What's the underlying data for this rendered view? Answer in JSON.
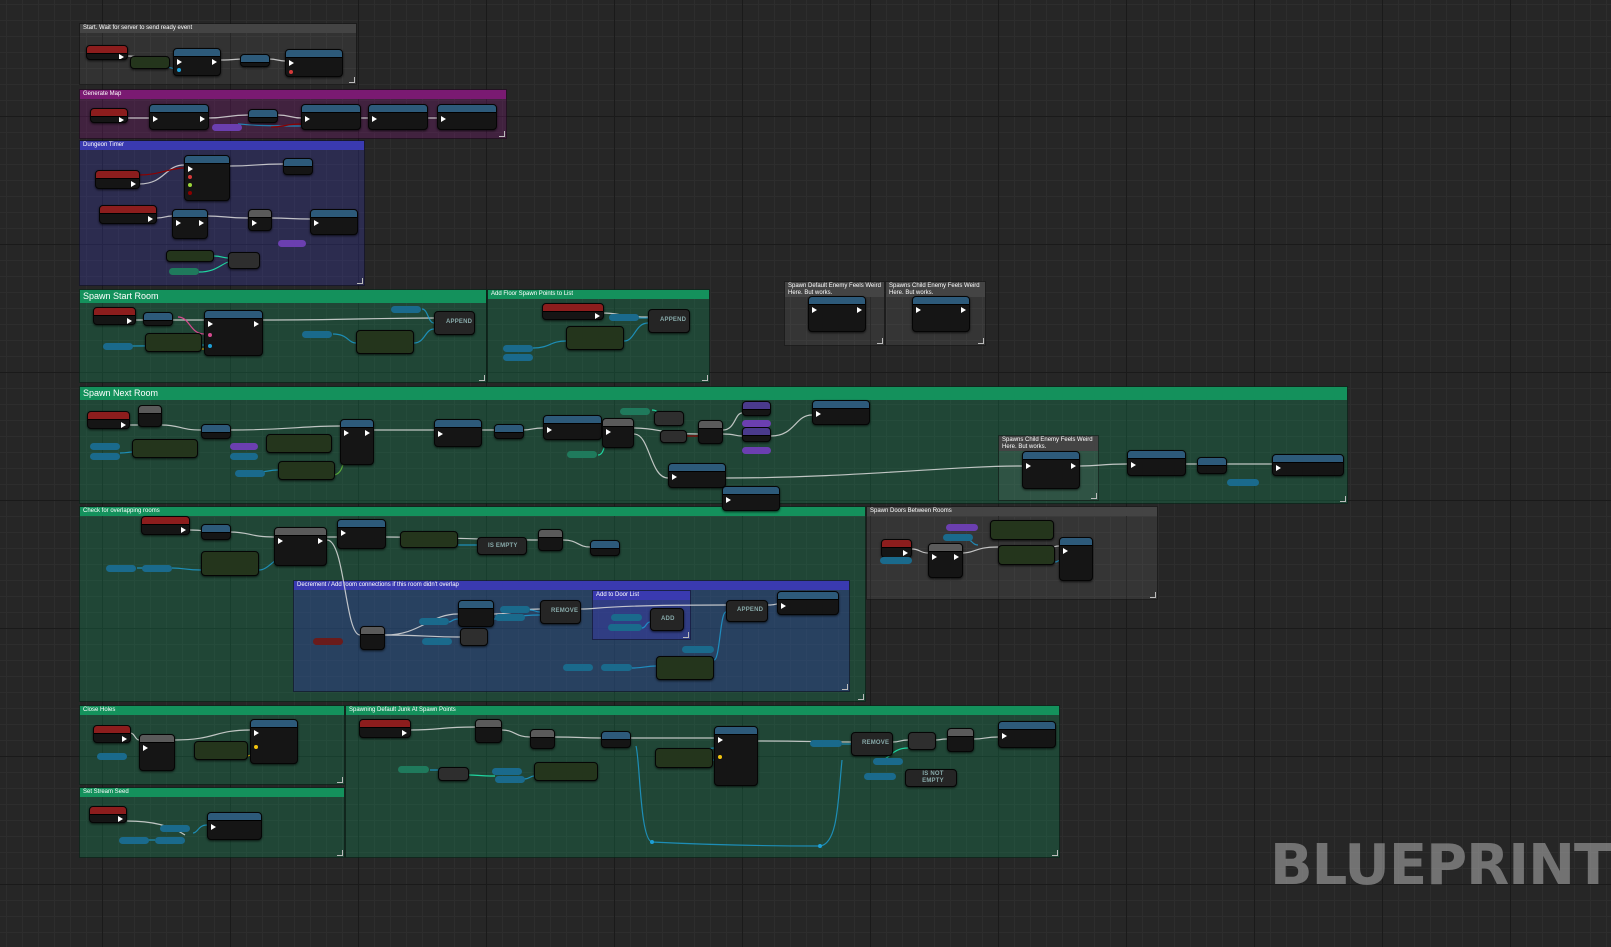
{
  "app": {
    "watermark": "BLUEPRINT"
  },
  "comments": [
    {
      "id": "start",
      "title": "Start. Wait for server to send ready event",
      "color": "#444444"
    },
    {
      "id": "generate-map",
      "title": "Generate Map",
      "color": "#7a1a72"
    },
    {
      "id": "dungeon-timer",
      "title": "Dungeon Timer",
      "color": "#3a3ab0"
    },
    {
      "id": "spawn-start-room",
      "title": "Spawn Start Room",
      "color": "#14915c"
    },
    {
      "id": "add-floor-spawn-points",
      "title": "Add Floor Spawn Points to List",
      "color": "#14915c"
    },
    {
      "id": "spawn-default-enemy",
      "title": "Spawn Default Enemy Feels Weird Here. But works.",
      "color": "#444444"
    },
    {
      "id": "spawn-child-enemy-top",
      "title": "Spawns Child Enemy Feels Weird Here. But works.",
      "color": "#444444"
    },
    {
      "id": "spawn-next-room",
      "title": "Spawn Next Room",
      "color": "#14915c"
    },
    {
      "id": "spawn-child-enemy-inner",
      "title": "Spawns Child Enemy Feels Weird Here. But works.",
      "color": "#444444"
    },
    {
      "id": "check-overlapping",
      "title": "Check for overlapping rooms",
      "color": "#14915c"
    },
    {
      "id": "spawn-doors",
      "title": "Spawn Doors Between Rooms",
      "color": "#444444"
    },
    {
      "id": "decrement-connections",
      "title": "Decrement / Add room connections if this room didn't overlap",
      "color": "#3a3ab0"
    },
    {
      "id": "add-to-door-list",
      "title": "Add to Door List",
      "color": "#3a3ab0"
    },
    {
      "id": "close-holes",
      "title": "Close Holes",
      "color": "#14915c"
    },
    {
      "id": "spawning-default-junk",
      "title": "Spawning Default Junk At Spawn Points",
      "color": "#14915c"
    },
    {
      "id": "set-stream-seed",
      "title": "Set Stream Seed",
      "color": "#14915c"
    }
  ],
  "macros": {
    "append": "APPEND",
    "remove": "REMOVE",
    "add": "ADD",
    "is_empty": "IS EMPTY",
    "is_not_empty": "IS NOT EMPTY"
  },
  "colors": {
    "event": "#8c1d1d",
    "function": "#2d5a7a",
    "pure": "#3d6b2a",
    "macro": "#5a5a5a",
    "exec_wire": "#e6e6e6",
    "object_wire": "#1d9fd6",
    "bool_wire": "#8c0000",
    "vector_wire": "#f2c40f",
    "int_wire": "#1fd6a0",
    "struct_wire": "#0a4fbf"
  }
}
